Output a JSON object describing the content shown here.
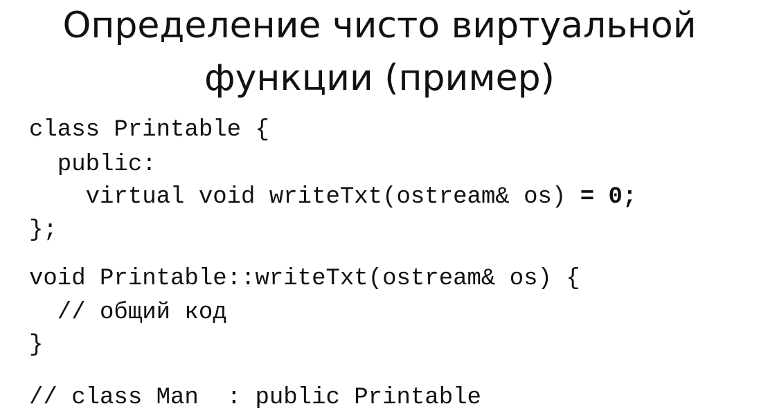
{
  "title": {
    "line1": "Определение чисто виртуальной",
    "line2": "функции (пример)"
  },
  "code": {
    "l1": "class Printable {",
    "l2": "  public:",
    "l3": "    virtual void writeTxt(ostream& os) ",
    "l3_bold": "= 0;",
    "l4": "};",
    "l5": "void Printable::writeTxt(ostream& os) {",
    "l6": "  // общий код",
    "l7": "}",
    "l8": "// class Man  : public Printable"
  }
}
